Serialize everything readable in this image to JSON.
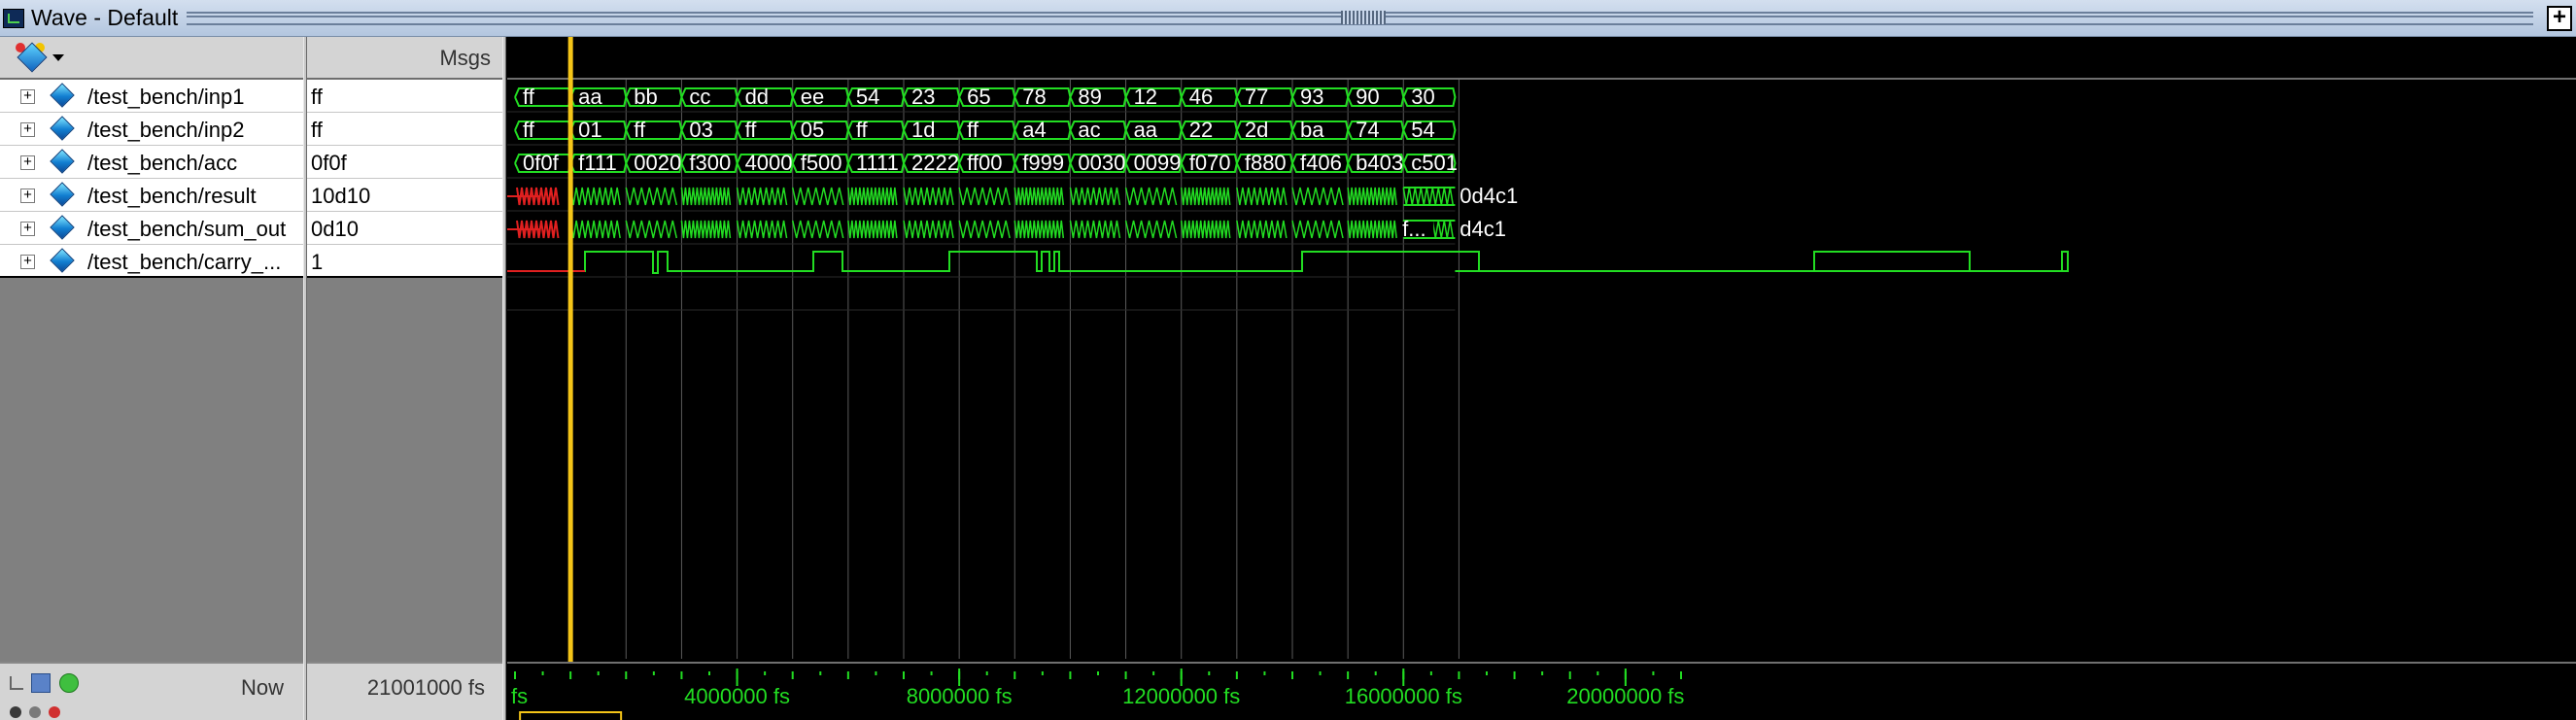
{
  "window": {
    "title": "Wave - Default",
    "undock_label": "+"
  },
  "names_header": {
    "icon": "signal-tool-icon"
  },
  "values_header": {
    "label": "Msgs"
  },
  "signals": [
    {
      "name": "/test_bench/inp1",
      "value": "ff"
    },
    {
      "name": "/test_bench/inp2",
      "value": "ff"
    },
    {
      "name": "/test_bench/acc",
      "value": "0f0f"
    },
    {
      "name": "/test_bench/result",
      "value": "10d10"
    },
    {
      "name": "/test_bench/sum_out",
      "value": "0d10"
    },
    {
      "name": "/test_bench/carry_...",
      "value": "1"
    }
  ],
  "expand_glyph": "+",
  "status": {
    "now_label": "Now",
    "now_value": "21001000 fs",
    "icons": [
      "zoom-icon",
      "wave-window-icon",
      "add-icon"
    ]
  },
  "timeline": {
    "unit": "fs",
    "origin_label": "fs",
    "labels": [
      {
        "t": 4000000,
        "text": "4000000 fs"
      },
      {
        "t": 8000000,
        "text": "8000000 fs"
      },
      {
        "t": 12000000,
        "text": "12000000 fs"
      },
      {
        "t": 16000000,
        "text": "16000000 fs"
      },
      {
        "t": 20000000,
        "text": "20000000 fs"
      }
    ],
    "cursor_time": 1000000,
    "colors": {
      "wave": "#22dd22",
      "cursor": "#f5c518",
      "grid": "#5a5a5a",
      "ruler": "#22dd22",
      "undefined": "#e02020"
    }
  },
  "waves": {
    "inp1": [
      "ff",
      "aa",
      "bb",
      "cc",
      "dd",
      "ee",
      "54",
      "23",
      "65",
      "78",
      "89",
      "12",
      "46",
      "77",
      "93",
      "90",
      "30"
    ],
    "inp2": [
      "ff",
      "01",
      "ff",
      "03",
      "ff",
      "05",
      "ff",
      "1d",
      "ff",
      "a4",
      "ac",
      "aa",
      "22",
      "2d",
      "ba",
      "74",
      "54"
    ],
    "acc": [
      "0f0f",
      "f111",
      "0020",
      "f300",
      "4000",
      "f500",
      "1111",
      "2222",
      "ff00",
      "f999",
      "0030",
      "0099",
      "f070",
      "f880",
      "f406",
      "b403",
      "c501"
    ],
    "result_final": "0d4c1",
    "sum_out_tail": "f...",
    "sum_out_final": "d4c1"
  }
}
